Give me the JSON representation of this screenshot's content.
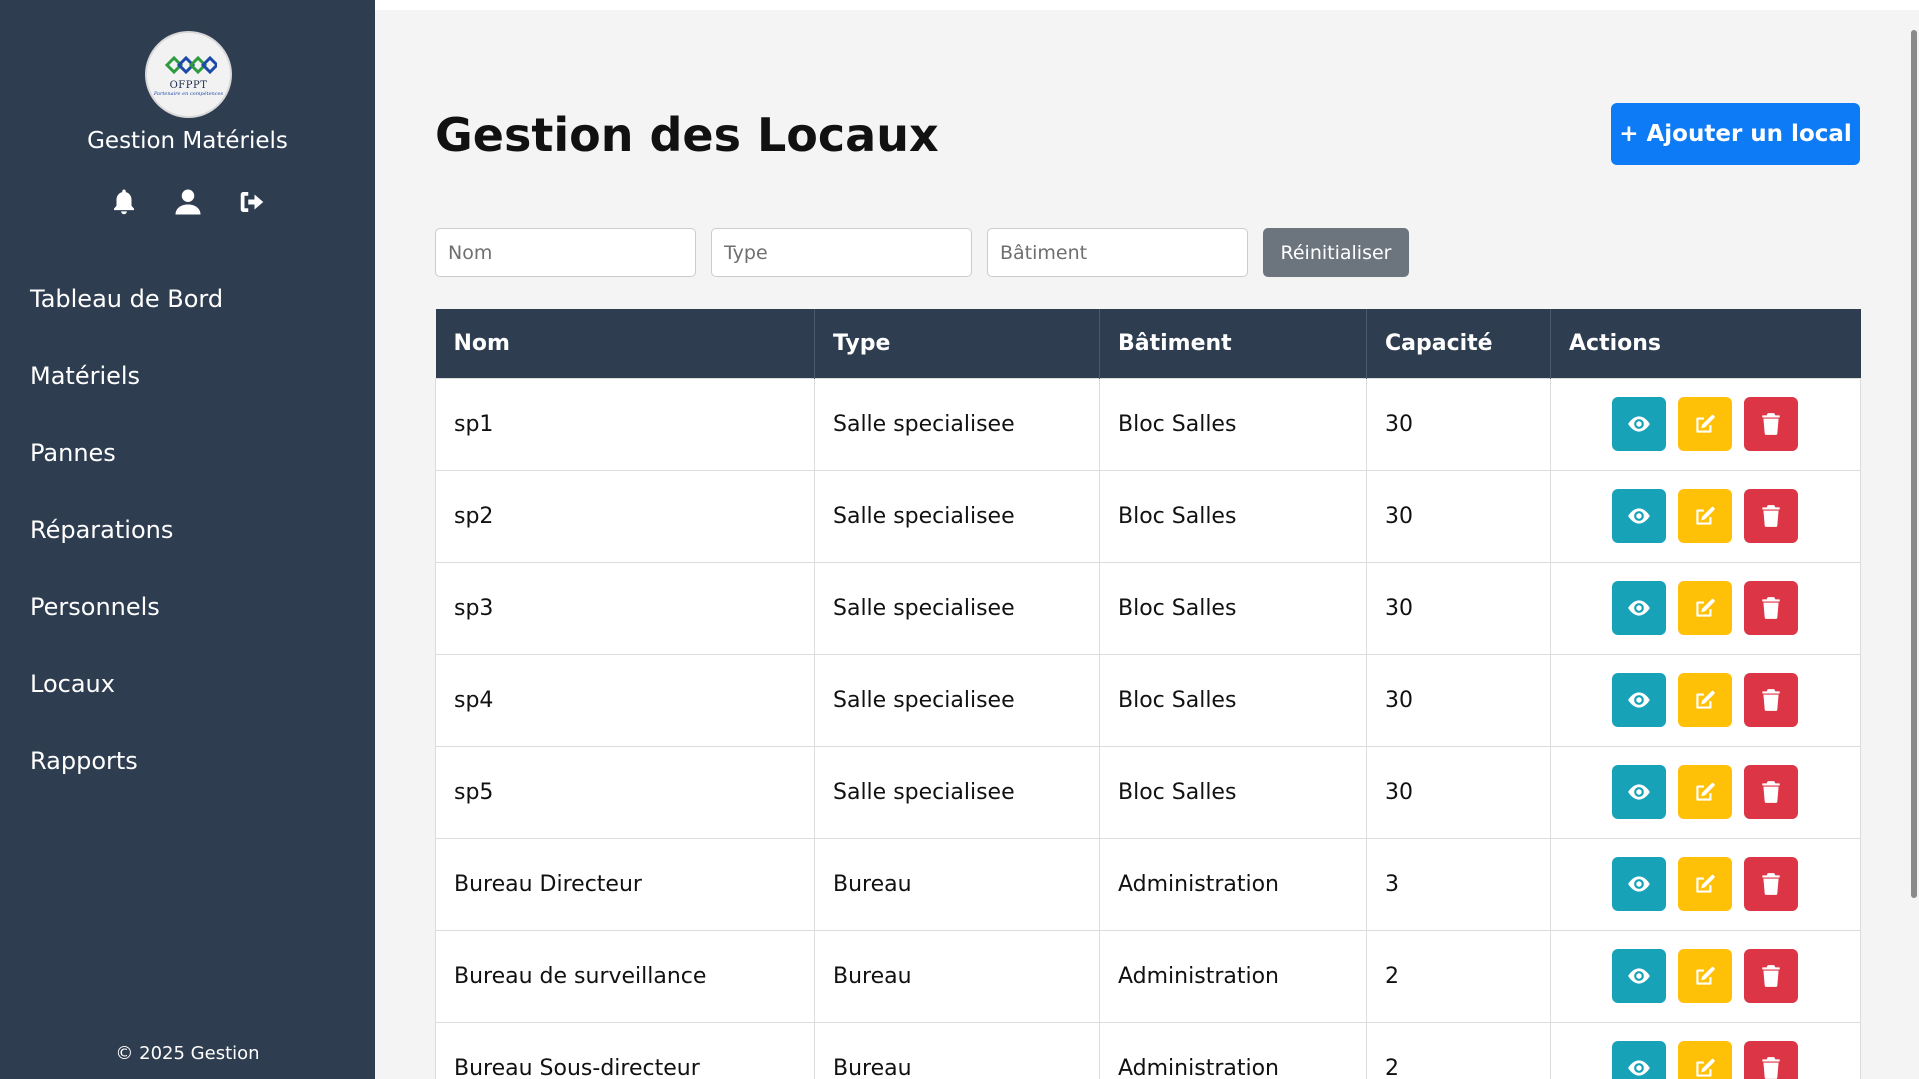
{
  "sidebar": {
    "logo_text": "OFPPT",
    "logo_sub": "Partenaire en compétences",
    "app_title": "Gestion Matériels",
    "items": [
      {
        "label": "Tableau de Bord"
      },
      {
        "label": "Matériels"
      },
      {
        "label": "Pannes"
      },
      {
        "label": "Réparations"
      },
      {
        "label": "Personnels"
      },
      {
        "label": "Locaux"
      },
      {
        "label": "Rapports"
      }
    ],
    "icons": [
      "bell-icon",
      "user-icon",
      "logout-icon"
    ],
    "footer": "© 2025 Gestion"
  },
  "header": {
    "title": "Gestion des Locaux",
    "add_button": "+ Ajouter un local"
  },
  "filters": {
    "nom_placeholder": "Nom",
    "type_placeholder": "Type",
    "batiment_placeholder": "Bâtiment",
    "reset_label": "Réinitialiser"
  },
  "table": {
    "columns": [
      "Nom",
      "Type",
      "Bâtiment",
      "Capacité",
      "Actions"
    ],
    "rows": [
      {
        "nom": "sp1",
        "type": "Salle specialisee",
        "batiment": "Bloc Salles",
        "capacite": "30"
      },
      {
        "nom": "sp2",
        "type": "Salle specialisee",
        "batiment": "Bloc Salles",
        "capacite": "30"
      },
      {
        "nom": "sp3",
        "type": "Salle specialisee",
        "batiment": "Bloc Salles",
        "capacite": "30"
      },
      {
        "nom": "sp4",
        "type": "Salle specialisee",
        "batiment": "Bloc Salles",
        "capacite": "30"
      },
      {
        "nom": "sp5",
        "type": "Salle specialisee",
        "batiment": "Bloc Salles",
        "capacite": "30"
      },
      {
        "nom": "Bureau Directeur",
        "type": "Bureau",
        "batiment": "Administration",
        "capacite": "3"
      },
      {
        "nom": "Bureau de surveillance",
        "type": "Bureau",
        "batiment": "Administration",
        "capacite": "2"
      },
      {
        "nom": "Bureau Sous-directeur",
        "type": "Bureau",
        "batiment": "Administration",
        "capacite": "2"
      }
    ]
  },
  "colors": {
    "sidebar": "#2e3d50",
    "primary": "#0d7bf5",
    "view": "#17a2b8",
    "edit": "#ffc107",
    "delete": "#dc3545",
    "secondary": "#6c757d"
  }
}
